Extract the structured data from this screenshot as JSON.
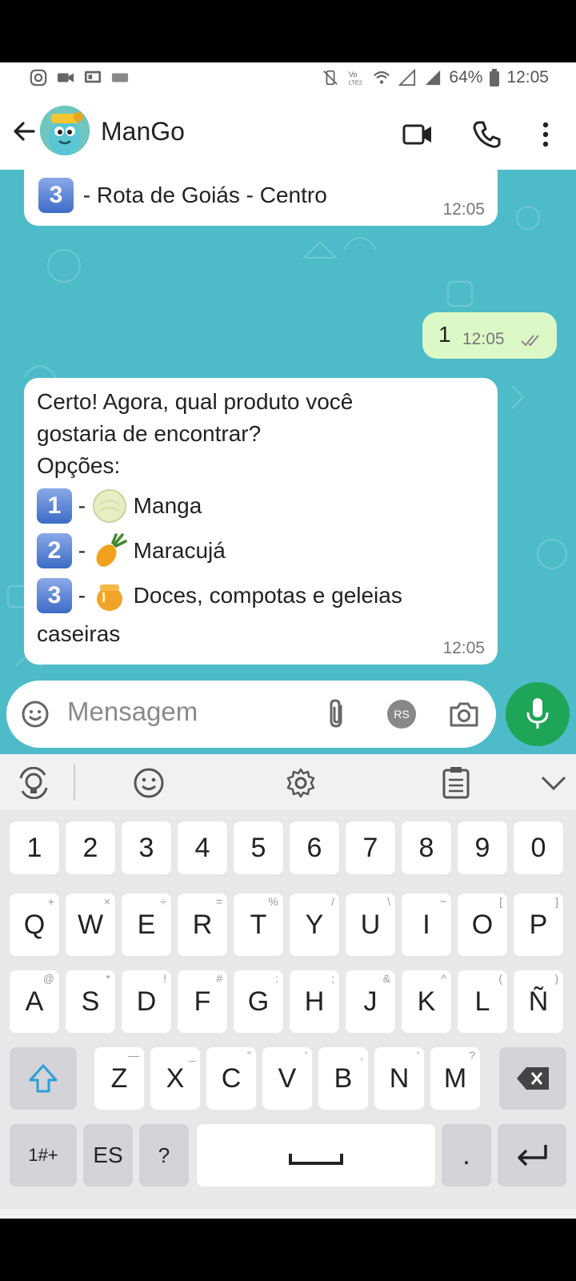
{
  "status_bar": {
    "battery": "64%",
    "time": "12:05"
  },
  "header": {
    "contact_name": "ManGo"
  },
  "messages": {
    "top_partial": {
      "number": "3",
      "text": "- Rota de Goiás - Centro",
      "time": "12:05"
    },
    "outgoing": {
      "text": "1",
      "time": "12:05"
    },
    "incoming": {
      "line1": "Certo! Agora, qual produto você",
      "line2": "gostaria de encontrar?",
      "line3": "Opções:",
      "options": [
        {
          "number": "1",
          "dash": "-",
          "emoji": "melon-icon",
          "label": "Manga"
        },
        {
          "number": "2",
          "dash": "-",
          "emoji": "pineapple-icon",
          "label": "Maracujá"
        },
        {
          "number": "3",
          "dash": "-",
          "emoji": "honey-pot-icon",
          "label": "Doces, compotas e geleias"
        }
      ],
      "option3_wrap": "caseiras",
      "time": "12:05"
    }
  },
  "input": {
    "placeholder": "Mensagem",
    "rs_badge": "RS"
  },
  "keyboard": {
    "row_numbers": [
      "1",
      "2",
      "3",
      "4",
      "5",
      "6",
      "7",
      "8",
      "9",
      "0"
    ],
    "row1": [
      {
        "k": "Q",
        "s": "+"
      },
      {
        "k": "W",
        "s": "×"
      },
      {
        "k": "E",
        "s": "÷"
      },
      {
        "k": "R",
        "s": "="
      },
      {
        "k": "T",
        "s": "%"
      },
      {
        "k": "Y",
        "s": "/"
      },
      {
        "k": "U",
        "s": "\\"
      },
      {
        "k": "I",
        "s": "~"
      },
      {
        "k": "O",
        "s": "["
      },
      {
        "k": "P",
        "s": "]"
      }
    ],
    "row2": [
      {
        "k": "A",
        "s": "@"
      },
      {
        "k": "S",
        "s": "*"
      },
      {
        "k": "D",
        "s": "!"
      },
      {
        "k": "F",
        "s": "#"
      },
      {
        "k": "G",
        "s": ":"
      },
      {
        "k": "H",
        "s": ";"
      },
      {
        "k": "J",
        "s": "&"
      },
      {
        "k": "K",
        "s": "^"
      },
      {
        "k": "L",
        "s": "("
      },
      {
        "k": "Ñ",
        "s": ")"
      }
    ],
    "row3": [
      {
        "k": "Z",
        "s": "—"
      },
      {
        "k": "X",
        "s": "_"
      },
      {
        "k": "C",
        "s": "\""
      },
      {
        "k": "V",
        "s": "'"
      },
      {
        "k": "B",
        "s": ","
      },
      {
        "k": "N",
        "s": "'"
      },
      {
        "k": "M",
        "s": "?"
      }
    ],
    "symbols_key": "1#+",
    "language_key": "ES",
    "question_key": "?",
    "period_key": "."
  },
  "icons": {
    "accent": "#1fa558",
    "chat_bg": "#4dbcc8",
    "outgoing_bg": "#dcf8c6"
  }
}
